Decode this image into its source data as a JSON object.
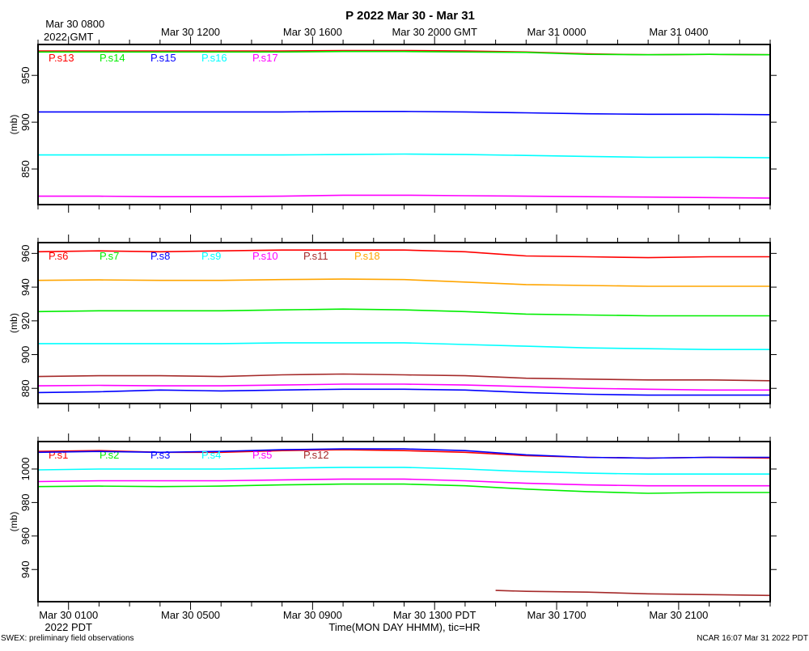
{
  "chart_data": {
    "type": "line",
    "title": "P 2022 Mar 30 - Mar 31",
    "xlabel": "Time(MON DAY HHMM), tic=HR",
    "footer_left": "SWEX: preliminary field observations",
    "footer_right": "NCAR 16:07 Mar 31 2022 PDT",
    "xlim_hours": [
      0,
      24
    ],
    "x_hours": [
      0,
      2,
      4,
      6,
      8,
      10,
      12,
      14,
      16,
      18,
      20,
      22,
      24
    ],
    "top_ticks": [
      {
        "hour": 1,
        "label": "Mar 30 0800",
        "label2": "2022 GMT"
      },
      {
        "hour": 5,
        "label": "Mar 30 1200"
      },
      {
        "hour": 9,
        "label": "Mar 30 1600"
      },
      {
        "hour": 13,
        "label": "Mar 30 2000 GMT"
      },
      {
        "hour": 17,
        "label": "Mar 31 0000"
      },
      {
        "hour": 21,
        "label": "Mar 31 0400"
      }
    ],
    "bottom_ticks": [
      {
        "hour": 1,
        "label": "Mar 30 0100",
        "label2": "2022 PDT"
      },
      {
        "hour": 5,
        "label": "Mar 30 0500"
      },
      {
        "hour": 9,
        "label": "Mar 30 0900"
      },
      {
        "hour": 13,
        "label": "Mar 30 1300 PDT"
      },
      {
        "hour": 17,
        "label": "Mar 30 1700"
      },
      {
        "hour": 21,
        "label": "Mar 30 2100"
      }
    ],
    "panels": [
      {
        "ylabel": "(mb)",
        "ylim": [
          812,
          983
        ],
        "yticks": [
          850,
          900,
          950
        ],
        "series": [
          {
            "name": "P.s13",
            "color": "#ff0000",
            "values": [
              976,
              976,
              976,
              976,
              976,
              976.5,
              976.5,
              976,
              975,
              973,
              972,
              972.5,
              972
            ]
          },
          {
            "name": "P.s14",
            "color": "#00ee00",
            "values": [
              975,
              975,
              975,
              975,
              975,
              975.5,
              975.5,
              975,
              974.5,
              972.5,
              972,
              972.5,
              972
            ]
          },
          {
            "name": "P.s15",
            "color": "#0000ff",
            "values": [
              911,
              911,
              911,
              911,
              911,
              911.5,
              911.5,
              911,
              910,
              909,
              908.5,
              908.5,
              908
            ]
          },
          {
            "name": "P.s16",
            "color": "#00ffff",
            "values": [
              865,
              865,
              865,
              865,
              865,
              865.5,
              866,
              865.5,
              864.5,
              863.5,
              862.5,
              862.5,
              862
            ]
          },
          {
            "name": "P.s17",
            "color": "#ff00ff",
            "values": [
              821,
              821,
              820.5,
              820.5,
              821,
              822,
              822,
              821.5,
              821,
              820.5,
              820,
              819.5,
              819
            ]
          }
        ]
      },
      {
        "ylabel": "(mb)",
        "ylim": [
          871,
          966.4
        ],
        "yticks": [
          880,
          900,
          920,
          940,
          960
        ],
        "series": [
          {
            "name": "P.s6",
            "color": "#ff0000",
            "values": [
              961,
              961.5,
              961,
              961.5,
              962,
              962,
              962,
              961,
              958.5,
              958,
              957.5,
              958,
              958
            ]
          },
          {
            "name": "P.s7",
            "color": "#00ee00",
            "values": [
              925.5,
              926,
              926,
              926,
              926.5,
              927,
              926.5,
              925.5,
              924,
              923.5,
              923,
              923,
              923
            ]
          },
          {
            "name": "P.s8",
            "color": "#0000ff",
            "values": [
              877.5,
              878,
              879,
              878.5,
              879,
              879.5,
              879.5,
              879,
              877.5,
              876.5,
              876,
              876,
              876
            ]
          },
          {
            "name": "P.s9",
            "color": "#00ffff",
            "values": [
              906.5,
              906.5,
              906.5,
              906.5,
              907,
              907,
              907,
              906,
              905,
              904,
              903.5,
              903,
              903
            ]
          },
          {
            "name": "P.s10",
            "color": "#ff00ff",
            "values": [
              881.5,
              881.8,
              881.5,
              881.5,
              882,
              882.5,
              882.5,
              882,
              881,
              880,
              879.5,
              879,
              879
            ]
          },
          {
            "name": "P.s11",
            "color": "#a52a2a",
            "values": [
              887,
              887.5,
              887.5,
              887,
              888,
              888.5,
              888,
              887.5,
              886,
              885.5,
              885,
              885,
              884.5
            ]
          },
          {
            "name": "P.s18",
            "color": "#ffa500",
            "values": [
              944,
              944.3,
              944,
              944,
              944.5,
              944.8,
              944.5,
              943,
              941.5,
              941,
              940.5,
              940.5,
              940.5
            ]
          }
        ]
      },
      {
        "ylabel": "(mb)",
        "ylim": [
          920.8,
          1016.4
        ],
        "yticks": [
          940,
          960,
          980,
          1000
        ],
        "series": [
          {
            "name": "P.s1",
            "color": "#ff0000",
            "values": [
              1010.5,
              1011,
              1010,
              1010,
              1011,
              1011.5,
              1011,
              1010,
              1008,
              1007,
              1006.5,
              1007,
              1006.5
            ]
          },
          {
            "name": "P.s2",
            "color": "#00ee00",
            "values": [
              989.5,
              989.8,
              989.5,
              989.8,
              990.5,
              991,
              991,
              990,
              988,
              986.5,
              985.5,
              986,
              986
            ]
          },
          {
            "name": "P.s3",
            "color": "#0000ff",
            "values": [
              1010,
              1010.5,
              1010,
              1010.5,
              1011.5,
              1012,
              1012,
              1011,
              1008.5,
              1007,
              1006.5,
              1007,
              1007
            ]
          },
          {
            "name": "P.s4",
            "color": "#00ffff",
            "values": [
              999.5,
              1000,
              1000,
              1000,
              1000.5,
              1001,
              1001,
              1000,
              998.5,
              997.5,
              997,
              997,
              997
            ]
          },
          {
            "name": "P.s5",
            "color": "#ff00ff",
            "values": [
              992.5,
              993,
              993,
              993,
              993.5,
              994,
              994,
              993,
              991.5,
              990.5,
              990,
              990,
              990
            ]
          },
          {
            "name": "P.s12",
            "color": "#a52a2a",
            "x_hours": [
              15,
              16,
              18,
              20,
              22,
              24
            ],
            "values": [
              927.5,
              927,
              926.5,
              925.5,
              925,
              924.5
            ]
          }
        ]
      }
    ]
  }
}
